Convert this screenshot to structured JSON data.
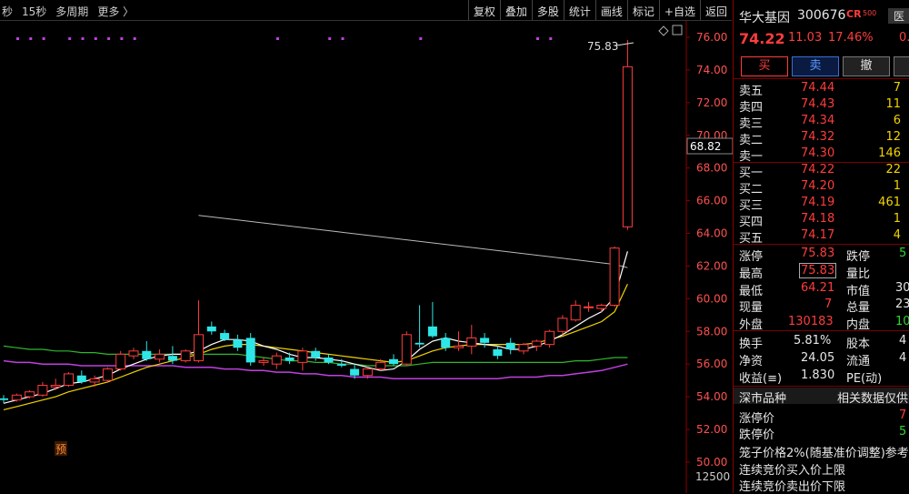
{
  "toolbar": {
    "left_items": [
      "秒",
      "15秒",
      "多周期",
      "更多 〉"
    ],
    "right_items": [
      "复权",
      "叠加",
      "多股",
      "统计",
      "画线",
      "标记",
      "+自选",
      "返回"
    ]
  },
  "chart": {
    "price_ticks": [
      "76.00",
      "74.00",
      "72.00",
      "70.00",
      "68.00",
      "66.00",
      "64.00",
      "62.00",
      "60.00",
      "58.00",
      "56.00",
      "54.00",
      "52.00",
      "50.00"
    ],
    "current_price_label": "68.82",
    "high_annotation": "75.83",
    "bottom_label": "12500",
    "pre_marker": "预",
    "colors": {
      "up": "#ff3c3c",
      "down": "#2ee6e6",
      "ma5": "#ffffff",
      "ma10": "#f2d400",
      "ma20": "#2fb82f",
      "ma60": "#c040e0",
      "cost_line": "#bbbbbb"
    }
  },
  "chart_data": {
    "type": "candlestick",
    "ylim": [
      50.5,
      76.8
    ],
    "candles": [
      {
        "o": 53.9,
        "h": 54.1,
        "l": 53.6,
        "c": 53.8
      },
      {
        "o": 53.8,
        "h": 54.2,
        "l": 53.7,
        "c": 54.1
      },
      {
        "o": 54.0,
        "h": 54.4,
        "l": 53.9,
        "c": 54.3
      },
      {
        "o": 54.1,
        "h": 54.9,
        "l": 54.0,
        "c": 54.7
      },
      {
        "o": 54.6,
        "h": 55.1,
        "l": 54.4,
        "c": 54.7
      },
      {
        "o": 54.7,
        "h": 55.5,
        "l": 54.6,
        "c": 55.4
      },
      {
        "o": 55.3,
        "h": 55.6,
        "l": 54.8,
        "c": 54.9
      },
      {
        "o": 54.9,
        "h": 55.3,
        "l": 54.6,
        "c": 55.1
      },
      {
        "o": 55.0,
        "h": 55.8,
        "l": 54.9,
        "c": 55.7
      },
      {
        "o": 55.7,
        "h": 56.8,
        "l": 55.6,
        "c": 56.6
      },
      {
        "o": 56.5,
        "h": 57.0,
        "l": 56.3,
        "c": 56.8
      },
      {
        "o": 56.8,
        "h": 57.4,
        "l": 56.2,
        "c": 56.3
      },
      {
        "o": 56.3,
        "h": 56.9,
        "l": 56.1,
        "c": 56.6
      },
      {
        "o": 56.5,
        "h": 57.1,
        "l": 56.0,
        "c": 56.2
      },
      {
        "o": 56.2,
        "h": 56.9,
        "l": 56.1,
        "c": 56.8
      },
      {
        "o": 56.2,
        "h": 59.9,
        "l": 56.1,
        "c": 57.8
      },
      {
        "o": 58.3,
        "h": 58.6,
        "l": 57.8,
        "c": 58.0
      },
      {
        "o": 57.9,
        "h": 58.1,
        "l": 57.4,
        "c": 57.5
      },
      {
        "o": 57.5,
        "h": 57.8,
        "l": 56.8,
        "c": 57.0
      },
      {
        "o": 57.6,
        "h": 57.9,
        "l": 55.9,
        "c": 56.1
      },
      {
        "o": 56.1,
        "h": 56.4,
        "l": 55.9,
        "c": 56.2
      },
      {
        "o": 56.0,
        "h": 56.7,
        "l": 55.7,
        "c": 56.5
      },
      {
        "o": 56.4,
        "h": 56.7,
        "l": 56.0,
        "c": 56.2
      },
      {
        "o": 56.1,
        "h": 57.0,
        "l": 55.6,
        "c": 56.8
      },
      {
        "o": 56.8,
        "h": 57.0,
        "l": 56.2,
        "c": 56.4
      },
      {
        "o": 56.4,
        "h": 56.6,
        "l": 56.0,
        "c": 56.1
      },
      {
        "o": 56.0,
        "h": 56.3,
        "l": 55.8,
        "c": 55.9
      },
      {
        "o": 55.7,
        "h": 56.0,
        "l": 55.1,
        "c": 55.3
      },
      {
        "o": 55.3,
        "h": 55.8,
        "l": 55.1,
        "c": 55.7
      },
      {
        "o": 55.7,
        "h": 56.3,
        "l": 55.6,
        "c": 56.1
      },
      {
        "o": 56.3,
        "h": 56.6,
        "l": 55.9,
        "c": 56.0
      },
      {
        "o": 56.0,
        "h": 58.0,
        "l": 55.9,
        "c": 57.8
      },
      {
        "o": 57.3,
        "h": 59.6,
        "l": 57.0,
        "c": 57.2
      },
      {
        "o": 58.3,
        "h": 59.8,
        "l": 57.6,
        "c": 57.7
      },
      {
        "o": 57.6,
        "h": 57.9,
        "l": 56.8,
        "c": 57.0
      },
      {
        "o": 57.0,
        "h": 58.0,
        "l": 56.8,
        "c": 57.1
      },
      {
        "o": 57.1,
        "h": 58.4,
        "l": 56.6,
        "c": 57.6
      },
      {
        "o": 57.6,
        "h": 57.9,
        "l": 57.0,
        "c": 57.3
      },
      {
        "o": 56.9,
        "h": 57.1,
        "l": 56.3,
        "c": 56.5
      },
      {
        "o": 57.3,
        "h": 57.6,
        "l": 56.6,
        "c": 56.9
      },
      {
        "o": 56.8,
        "h": 57.3,
        "l": 56.6,
        "c": 57.2
      },
      {
        "o": 57.1,
        "h": 57.5,
        "l": 56.8,
        "c": 57.4
      },
      {
        "o": 57.2,
        "h": 58.1,
        "l": 57.0,
        "c": 58.0
      },
      {
        "o": 58.0,
        "h": 59.0,
        "l": 57.8,
        "c": 58.8
      },
      {
        "o": 58.7,
        "h": 59.9,
        "l": 58.6,
        "c": 59.6
      },
      {
        "o": 59.5,
        "h": 59.8,
        "l": 59.2,
        "c": 59.5
      },
      {
        "o": 59.4,
        "h": 59.7,
        "l": 59.2,
        "c": 59.6
      },
      {
        "o": 59.6,
        "h": 63.2,
        "l": 59.5,
        "c": 63.1
      },
      {
        "o": 64.4,
        "h": 75.83,
        "l": 64.21,
        "c": 74.2
      }
    ],
    "ma5": [
      53.6,
      53.8,
      54.0,
      54.2,
      54.5,
      54.8,
      54.9,
      55.1,
      55.3,
      55.7,
      56.0,
      56.3,
      56.5,
      56.6,
      56.6,
      56.8,
      57.2,
      57.5,
      57.5,
      57.4,
      57.1,
      56.9,
      56.6,
      56.4,
      56.4,
      56.3,
      56.2,
      56.0,
      55.8,
      55.6,
      55.7,
      56.2,
      56.9,
      57.4,
      57.6,
      57.4,
      57.3,
      57.2,
      57.1,
      56.9,
      56.9,
      57.1,
      57.4,
      57.8,
      58.3,
      58.8,
      59.2,
      60.1,
      62.9
    ],
    "ma10": [
      53.2,
      53.4,
      53.6,
      53.8,
      54.0,
      54.3,
      54.5,
      54.7,
      54.9,
      55.2,
      55.5,
      55.8,
      56.0,
      56.2,
      56.4,
      56.6,
      56.9,
      57.1,
      57.2,
      57.2,
      57.1,
      57.0,
      56.9,
      56.8,
      56.7,
      56.6,
      56.5,
      56.4,
      56.3,
      56.2,
      56.1,
      56.2,
      56.5,
      56.8,
      57.0,
      57.1,
      57.2,
      57.2,
      57.2,
      57.2,
      57.2,
      57.3,
      57.5,
      57.7,
      58.0,
      58.3,
      58.6,
      59.2,
      60.9
    ],
    "ma20": [
      57.1,
      57.0,
      56.9,
      56.9,
      56.8,
      56.8,
      56.7,
      56.7,
      56.6,
      56.6,
      56.6,
      56.6,
      56.6,
      56.6,
      56.6,
      56.6,
      56.6,
      56.6,
      56.6,
      56.5,
      56.4,
      56.3,
      56.2,
      56.2,
      56.1,
      56.1,
      56.0,
      56.0,
      55.9,
      55.9,
      55.9,
      55.9,
      56.0,
      56.1,
      56.1,
      56.1,
      56.1,
      56.1,
      56.1,
      56.1,
      56.1,
      56.1,
      56.1,
      56.1,
      56.2,
      56.2,
      56.3,
      56.4,
      56.4
    ],
    "ma60": [
      56.2,
      56.1,
      56.1,
      56.0,
      56.0,
      56.0,
      55.9,
      55.9,
      55.9,
      55.9,
      55.9,
      55.9,
      55.9,
      55.9,
      55.8,
      55.8,
      55.8,
      55.7,
      55.7,
      55.6,
      55.6,
      55.5,
      55.5,
      55.4,
      55.4,
      55.3,
      55.3,
      55.2,
      55.2,
      55.2,
      55.1,
      55.1,
      55.1,
      55.1,
      55.1,
      55.1,
      55.1,
      55.1,
      55.1,
      55.2,
      55.2,
      55.2,
      55.3,
      55.3,
      55.4,
      55.5,
      55.6,
      55.8,
      56.0
    ],
    "cost_line": [
      {
        "i": 15,
        "v": 65.1
      },
      {
        "i": 47,
        "v": 62.1
      },
      {
        "i": 48,
        "v": 61.9
      }
    ]
  },
  "quote": {
    "name": "华大基因",
    "code": "300676",
    "badge": "CR",
    "badge_sub": "500",
    "tag": "医",
    "price": "74.22",
    "change": "11.03",
    "pct": "17.46%",
    "tail": "0.",
    "buttons": [
      "买",
      "卖",
      "撤"
    ]
  },
  "asks": [
    {
      "label": "卖五",
      "price": "74.44",
      "vol": "7"
    },
    {
      "label": "卖四",
      "price": "74.43",
      "vol": "11"
    },
    {
      "label": "卖三",
      "price": "74.34",
      "vol": "6"
    },
    {
      "label": "卖二",
      "price": "74.32",
      "vol": "12"
    },
    {
      "label": "卖一",
      "price": "74.30",
      "vol": "146"
    }
  ],
  "bids": [
    {
      "label": "买一",
      "price": "74.22",
      "vol": "22"
    },
    {
      "label": "买二",
      "price": "74.20",
      "vol": "1"
    },
    {
      "label": "买三",
      "price": "74.19",
      "vol": "461"
    },
    {
      "label": "买四",
      "price": "74.18",
      "vol": "1"
    },
    {
      "label": "买五",
      "price": "74.17",
      "vol": "4"
    }
  ],
  "stats": {
    "zhangting_label": "涨停",
    "zhangting": "75.83",
    "dieting_label": "跌停",
    "dieting": "5",
    "high_label": "最高",
    "high": "75.83",
    "liangbi_label": "量比",
    "liangbi": "",
    "low_label": "最低",
    "low": "64.21",
    "shizhi_label": "市值",
    "shizhi": "30",
    "xianliang_label": "现量",
    "xianliang": "7",
    "zongliang_label": "总量",
    "zongliang": "23",
    "waipan_label": "外盘",
    "waipan": "130183",
    "neipan_label": "内盘",
    "neipan": "10",
    "huanshou_label": "换手",
    "huanshou": "5.81%",
    "guben_label": "股本",
    "guben": "4",
    "jingzi_label": "净资",
    "jingzi": "24.05",
    "liutong_label": "流通",
    "liutong": "4",
    "shouyi_label": "收益(≡)",
    "shouyi": "1.830",
    "pe_label": "PE(动)",
    "pe": ""
  },
  "footer": {
    "market_label": "深市品种",
    "related_label": "相关数据仅供",
    "zt_label": "涨停价",
    "zt_val": "7",
    "dt_label": "跌停价",
    "dt_val": "5",
    "cage_label": "笼子价格2%(随基准价调整)参考",
    "buy_limit_label": "连续竞价买入价上限",
    "sell_limit_label": "连续竞价卖出价下限"
  }
}
